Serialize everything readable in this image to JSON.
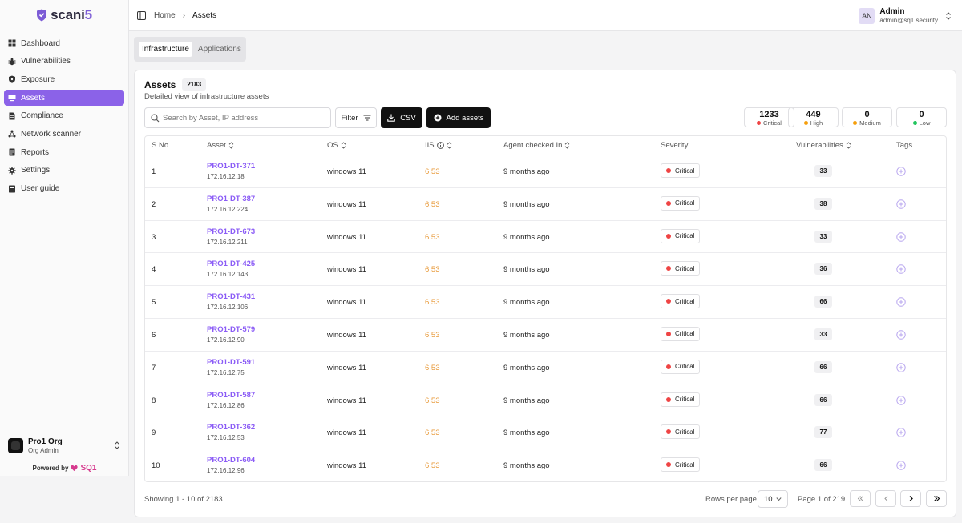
{
  "app": {
    "logo_text": "scani",
    "logo_suffix": "5"
  },
  "sidebar": {
    "items": [
      {
        "label": "Dashboard",
        "icon": "dashboard-icon",
        "active": false
      },
      {
        "label": "Vulnerabilities",
        "icon": "bug-icon",
        "active": false
      },
      {
        "label": "Exposure",
        "icon": "shield-icon",
        "active": false
      },
      {
        "label": "Assets",
        "icon": "monitor-icon",
        "active": true
      },
      {
        "label": "Compliance",
        "icon": "document-icon",
        "active": false
      },
      {
        "label": "Network scanner",
        "icon": "network-icon",
        "active": false
      },
      {
        "label": "Reports",
        "icon": "report-icon",
        "active": false
      },
      {
        "label": "Settings",
        "icon": "gear-icon",
        "active": false
      },
      {
        "label": "User guide",
        "icon": "book-icon",
        "active": false
      }
    ],
    "org": {
      "name": "Pro1 Org",
      "role": "Org Admin"
    },
    "powered": {
      "label": "Powered by",
      "brand": "SQ1"
    }
  },
  "topbar": {
    "breadcrumb": [
      "Home",
      "Assets"
    ],
    "user": {
      "initials": "AN",
      "name": "Admin",
      "email": "admin@sq1.security"
    }
  },
  "tabs": [
    {
      "label": "Infrastructure",
      "active": true
    },
    {
      "label": "Applications",
      "active": false
    }
  ],
  "card": {
    "title": "Assets",
    "count": "2183",
    "subtitle": "Detailed view of infrastructure assets",
    "search_placeholder": "Search by Asset, IP address",
    "filter_label": "Filter",
    "csv_label": "CSV",
    "add_label": "Add assets",
    "severity_summary": [
      {
        "count": "1233",
        "label": "Critical",
        "color": "#ef4444"
      },
      {
        "count": "449",
        "label": "High",
        "color": "#f59e0b"
      },
      {
        "count": "0",
        "label": "Medium",
        "color": "#f59e0b"
      },
      {
        "count": "0",
        "label": "Low",
        "color": "#22c55e"
      }
    ]
  },
  "table": {
    "headers": {
      "sno": "S.No",
      "asset": "Asset",
      "os": "OS",
      "iis": "IIS",
      "agent": "Agent checked In",
      "severity": "Severity",
      "vulnerabilities": "Vulnerabilities",
      "tags": "Tags"
    },
    "rows": [
      {
        "sno": "1",
        "name": "PRO1-DT-371",
        "ip": "172.16.12.18",
        "os": "windows 11",
        "iis": "6.53",
        "agent": "9 months ago",
        "severity": "Critical",
        "vulns": "33"
      },
      {
        "sno": "2",
        "name": "PRO1-DT-387",
        "ip": "172.16.12.224",
        "os": "windows 11",
        "iis": "6.53",
        "agent": "9 months ago",
        "severity": "Critical",
        "vulns": "38"
      },
      {
        "sno": "3",
        "name": "PRO1-DT-673",
        "ip": "172.16.12.211",
        "os": "windows 11",
        "iis": "6.53",
        "agent": "9 months ago",
        "severity": "Critical",
        "vulns": "33"
      },
      {
        "sno": "4",
        "name": "PRO1-DT-425",
        "ip": "172.16.12.143",
        "os": "windows 11",
        "iis": "6.53",
        "agent": "9 months ago",
        "severity": "Critical",
        "vulns": "36"
      },
      {
        "sno": "5",
        "name": "PRO1-DT-431",
        "ip": "172.16.12.106",
        "os": "windows 11",
        "iis": "6.53",
        "agent": "9 months ago",
        "severity": "Critical",
        "vulns": "66"
      },
      {
        "sno": "6",
        "name": "PRO1-DT-579",
        "ip": "172.16.12.90",
        "os": "windows 11",
        "iis": "6.53",
        "agent": "9 months ago",
        "severity": "Critical",
        "vulns": "33"
      },
      {
        "sno": "7",
        "name": "PRO1-DT-591",
        "ip": "172.16.12.75",
        "os": "windows 11",
        "iis": "6.53",
        "agent": "9 months ago",
        "severity": "Critical",
        "vulns": "66"
      },
      {
        "sno": "8",
        "name": "PRO1-DT-587",
        "ip": "172.16.12.86",
        "os": "windows 11",
        "iis": "6.53",
        "agent": "9 months ago",
        "severity": "Critical",
        "vulns": "66"
      },
      {
        "sno": "9",
        "name": "PRO1-DT-362",
        "ip": "172.16.12.53",
        "os": "windows 11",
        "iis": "6.53",
        "agent": "9 months ago",
        "severity": "Critical",
        "vulns": "77"
      },
      {
        "sno": "10",
        "name": "PRO1-DT-604",
        "ip": "172.16.12.96",
        "os": "windows 11",
        "iis": "6.53",
        "agent": "9 months ago",
        "severity": "Critical",
        "vulns": "66"
      }
    ]
  },
  "footer": {
    "showing": "Showing 1 - 10 of 2183",
    "rows_per_page_label": "Rows per page",
    "rows_per_page_value": "10",
    "page_info": "Page 1 of 219"
  }
}
